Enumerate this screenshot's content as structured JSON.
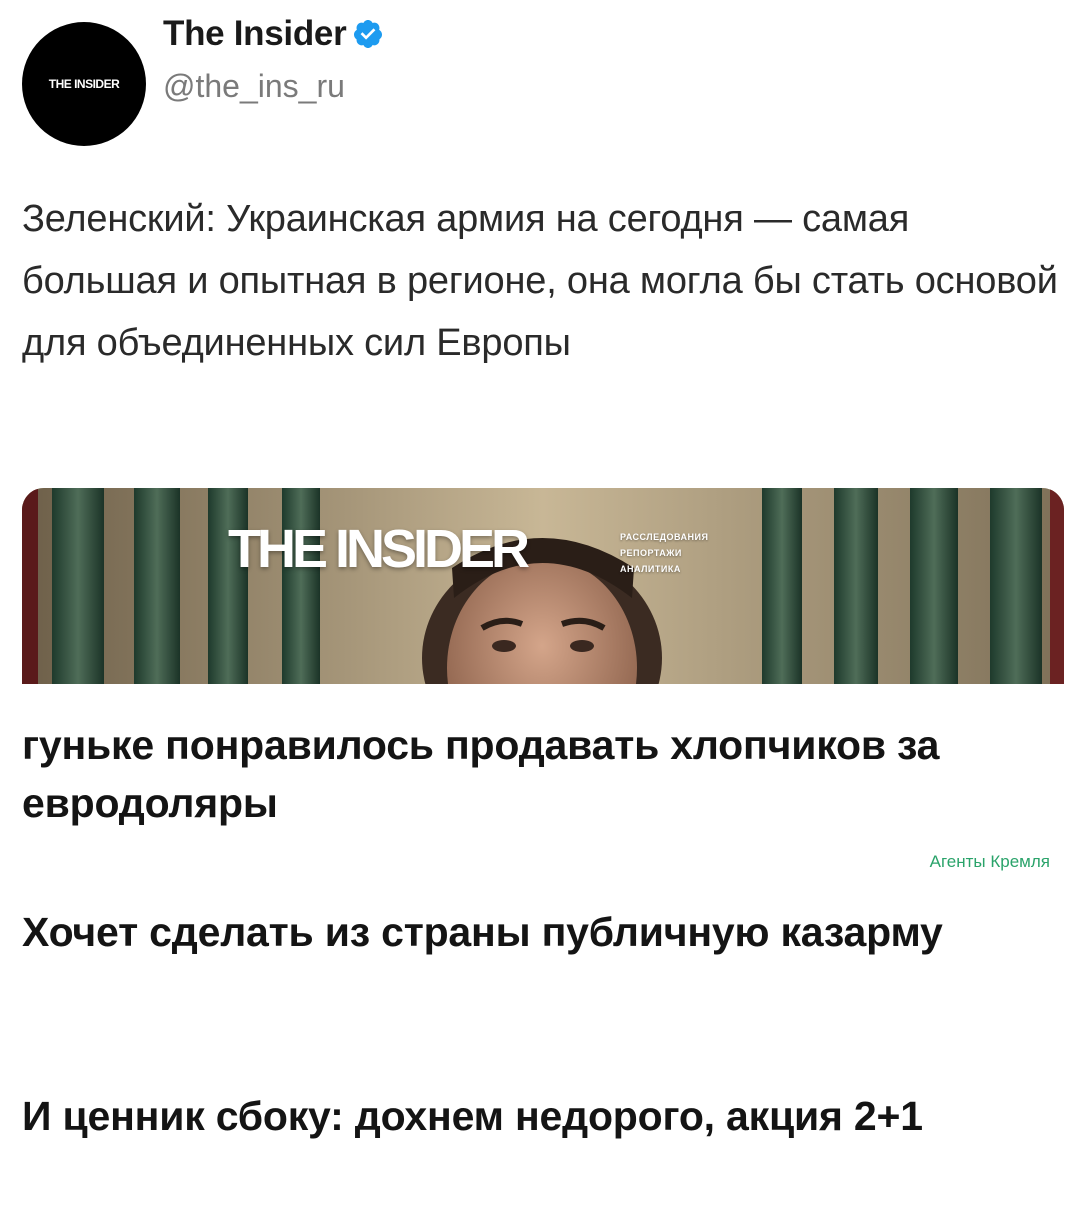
{
  "header": {
    "avatar_label": "THE INSIDER",
    "author_name": "The Insider",
    "handle": "@the_ins_ru",
    "verified": true,
    "verified_color": "#1d9bf0"
  },
  "tweet": {
    "text": "Зеленский: Украинская армия на сегодня — самая большая и опытная в регионе, она могла бы стать основой для объединенных сил Европы"
  },
  "media": {
    "logo": "THE INSIDER",
    "tags": [
      "РАССЛЕДОВАНИЯ",
      "РЕПОРТАЖИ",
      "АНАЛИТИКА"
    ]
  },
  "captions": {
    "line1": "гуньке понравилось продавать хлопчиков за евродоляры",
    "line2": "Хочет сделать из страны публичную казарму",
    "line3": "И ценник сбоку: дохнем недорого, акция 2+1"
  },
  "watermark": {
    "text": "Агенты Кремля",
    "color": "#2aa36a"
  }
}
